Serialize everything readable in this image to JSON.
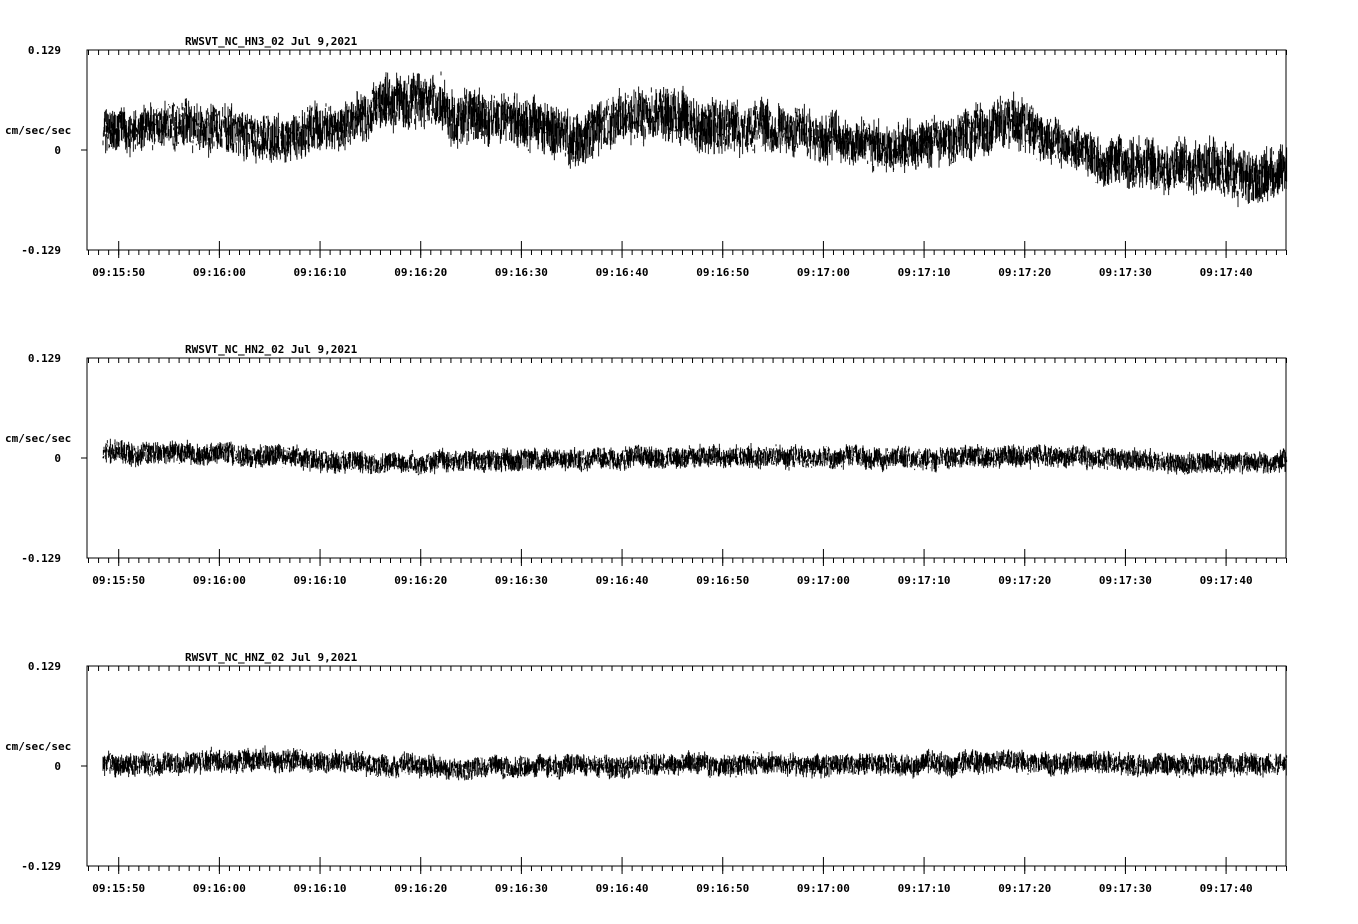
{
  "chart_data": [
    {
      "type": "line",
      "title": "RWSVT_NC_HN3_02  Jul 9,2021",
      "ylabel": "cm/sec/sec",
      "ylim": [
        -0.129,
        0.129
      ],
      "yticks": [
        "0.129",
        "0",
        "-0.129"
      ],
      "xticks": [
        "09:15:50",
        "09:16:00",
        "09:16:10",
        "09:16:20",
        "09:16:30",
        "09:16:40",
        "09:16:50",
        "09:17:00",
        "09:17:10",
        "09:17:20",
        "09:17:30",
        "09:17:40"
      ],
      "x_range_s": [
        46.9,
        166.0
      ],
      "series": [
        {
          "color": "#000000",
          "data_start_s": 48.5,
          "envelope_s": [
            48.5,
            54,
            60,
            66,
            72,
            78,
            84,
            90,
            96,
            102,
            108,
            114,
            120,
            126,
            132,
            138,
            144,
            150,
            156,
            162,
            166
          ],
          "envelope_mean": [
            0.02,
            0.035,
            0.025,
            0.015,
            0.03,
            0.065,
            0.045,
            0.04,
            0.015,
            0.05,
            0.03,
            0.035,
            0.015,
            0.005,
            0.01,
            0.035,
            0.005,
            -0.02,
            -0.02,
            -0.03,
            -0.025
          ],
          "envelope_halfwidth": [
            0.03,
            0.035,
            0.035,
            0.035,
            0.035,
            0.04,
            0.04,
            0.04,
            0.04,
            0.04,
            0.04,
            0.04,
            0.035,
            0.035,
            0.035,
            0.04,
            0.035,
            0.035,
            0.04,
            0.04,
            0.04
          ]
        }
      ]
    },
    {
      "type": "line",
      "title": "RWSVT_NC_HN2_02  Jul 9,2021",
      "ylabel": "cm/sec/sec",
      "ylim": [
        -0.129,
        0.129
      ],
      "yticks": [
        "0.129",
        "0",
        "-0.129"
      ],
      "xticks": [
        "09:15:50",
        "09:16:00",
        "09:16:10",
        "09:16:20",
        "09:16:30",
        "09:16:40",
        "09:16:50",
        "09:17:00",
        "09:17:10",
        "09:17:20",
        "09:17:30",
        "09:17:40"
      ],
      "x_range_s": [
        46.9,
        166.0
      ],
      "series": [
        {
          "color": "#000000",
          "data_start_s": 48.5,
          "envelope_s": [
            48.5,
            54,
            60,
            66,
            72,
            78,
            84,
            90,
            96,
            102,
            108,
            114,
            120,
            126,
            132,
            138,
            144,
            150,
            156,
            162,
            166
          ],
          "envelope_mean": [
            0.008,
            0.006,
            0.004,
            0.002,
            -0.006,
            -0.008,
            -0.004,
            -0.002,
            -0.002,
            0.0,
            0.001,
            0.001,
            0.0,
            0.0,
            0.001,
            0.002,
            0.001,
            -0.001,
            -0.006,
            -0.005,
            -0.004
          ],
          "envelope_halfwidth": [
            0.018,
            0.016,
            0.016,
            0.016,
            0.016,
            0.016,
            0.016,
            0.016,
            0.016,
            0.016,
            0.016,
            0.016,
            0.016,
            0.016,
            0.016,
            0.016,
            0.016,
            0.016,
            0.016,
            0.016,
            0.016
          ]
        }
      ]
    },
    {
      "type": "line",
      "title": "RWSVT_NC_HNZ_02  Jul 9,2021",
      "ylabel": "cm/sec/sec",
      "ylim": [
        -0.129,
        0.129
      ],
      "yticks": [
        "0.129",
        "0",
        "-0.129"
      ],
      "xticks": [
        "09:15:50",
        "09:16:00",
        "09:16:10",
        "09:16:20",
        "09:16:30",
        "09:16:40",
        "09:16:50",
        "09:17:00",
        "09:17:10",
        "09:17:20",
        "09:17:30",
        "09:17:40"
      ],
      "x_range_s": [
        46.9,
        166.0
      ],
      "series": [
        {
          "color": "#000000",
          "data_start_s": 48.5,
          "envelope_s": [
            48.5,
            54,
            60,
            66,
            72,
            78,
            84,
            90,
            96,
            102,
            108,
            114,
            120,
            126,
            132,
            138,
            144,
            150,
            156,
            162,
            166
          ],
          "envelope_mean": [
            0.0,
            0.002,
            0.005,
            0.008,
            0.004,
            0.0,
            -0.001,
            0.0,
            0.0,
            0.001,
            0.002,
            0.001,
            0.0,
            0.002,
            0.004,
            0.005,
            0.003,
            0.002,
            0.002,
            0.001,
            0.0
          ],
          "envelope_halfwidth": [
            0.016,
            0.016,
            0.017,
            0.017,
            0.016,
            0.016,
            0.016,
            0.016,
            0.016,
            0.016,
            0.016,
            0.016,
            0.016,
            0.016,
            0.017,
            0.016,
            0.016,
            0.016,
            0.016,
            0.016,
            0.016
          ]
        }
      ]
    }
  ]
}
